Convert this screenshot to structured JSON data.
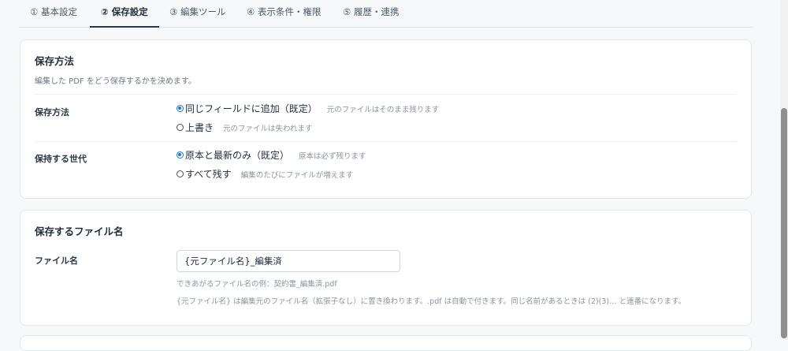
{
  "tabs": [
    {
      "label": "① 基本設定"
    },
    {
      "label": "② 保存設定"
    },
    {
      "label": "③ 編集ツール"
    },
    {
      "label": "④ 表示条件・権限"
    },
    {
      "label": "⑤ 履歴・連携"
    }
  ],
  "active_tab": "② 保存設定",
  "save_method_card": {
    "title": "保存方法",
    "description": "編集した PDF をどう保存するかを決めます。",
    "method": {
      "label": "保存方法",
      "options": [
        {
          "label": "同じフィールドに追加（既定）",
          "note": "元のファイルはそのまま残ります",
          "checked": true
        },
        {
          "label": "上書き",
          "note": "元のファイルは失われます",
          "checked": false
        }
      ]
    },
    "generations": {
      "label": "保持する世代",
      "options": [
        {
          "label": "原本と最新のみ（既定）",
          "note": "原本は必ず残ります",
          "checked": true
        },
        {
          "label": "すべて残す",
          "note": "編集のたびにファイルが増えます",
          "checked": false
        }
      ]
    }
  },
  "filename_card": {
    "title": "保存するファイル名",
    "field_label": "ファイル名",
    "field_value": "{元ファイル名}_編集済",
    "example": "できあがるファイル名の例：契約書_編集済.pdf",
    "note": "{元ファイル名} は編集元のファイル名（拡張子なし）に置き換わります。.pdf は自動で付きます。同じ名前があるときは (2)(3)… と連番になります。"
  },
  "colors": {
    "accent": "#1a73e8",
    "active_tab_underline": "#1f3a5f",
    "muted_text": "#8a94a0"
  }
}
